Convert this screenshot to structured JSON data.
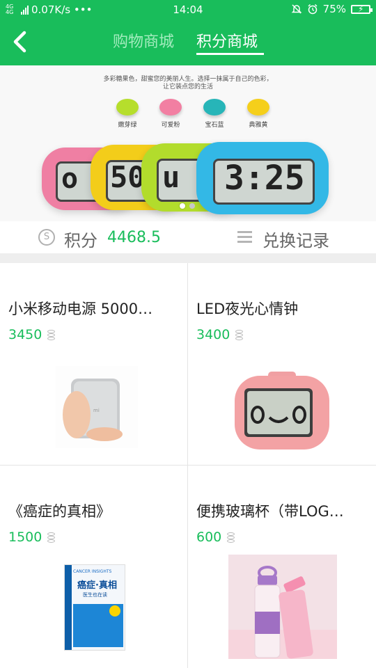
{
  "status_bar": {
    "network_tag": "4G 4G",
    "speed": "0.07K/s •••",
    "time": "14:04",
    "battery_percent": "75%"
  },
  "header": {
    "tab_shop": "购物商城",
    "tab_points": "积分商城",
    "accent_color": "#19bd5b"
  },
  "banner": {
    "line1": "多彩糖果色，甜蜜您的美丽人生。选择一抹属于自己的色彩，",
    "line2": "让它装点您的生活",
    "swatches": [
      {
        "label": "嫩芽绿",
        "color": "#b6de2c"
      },
      {
        "label": "可爱粉",
        "color": "#f27fa2"
      },
      {
        "label": "宝石蓝",
        "color": "#27b5b8"
      },
      {
        "label": "典雅黄",
        "color": "#f5cf1b"
      }
    ],
    "clock_digits": [
      "o",
      "50",
      "u",
      "3:25"
    ],
    "slide_count": 2,
    "active_slide": 1
  },
  "points": {
    "label": "积分",
    "value": "4468.5",
    "history_label": "兑换记录"
  },
  "products": [
    {
      "name": "小米移动电源 5000…",
      "price": "3450",
      "image": "power-bank"
    },
    {
      "name": "LED夜光心情钟",
      "price": "3400",
      "image": "pink-clock"
    },
    {
      "name": "《癌症的真相》",
      "price": "1500",
      "image": "book-cover"
    },
    {
      "name": "便携玻璃杯（带LOG…",
      "price": "600",
      "image": "glass-bottle"
    }
  ],
  "book_cover": {
    "title_en": "CANCER INSIGHTS",
    "title_cn": "癌症·真相",
    "subtitle": "医生也在读"
  }
}
